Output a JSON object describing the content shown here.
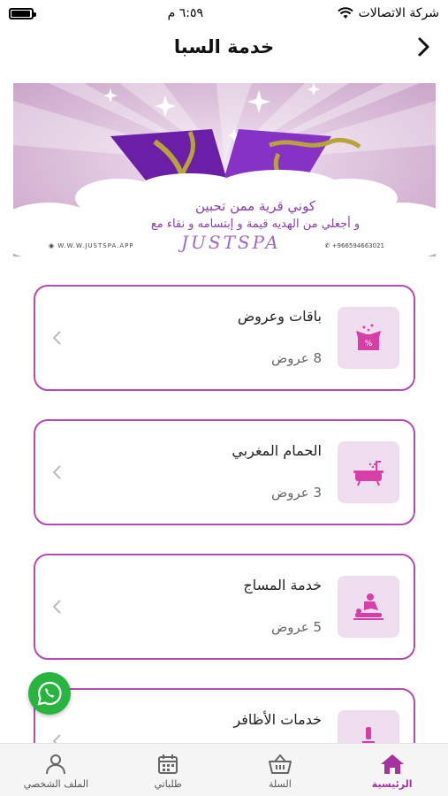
{
  "status_bar": {
    "carrier": "شركة الاتصالات",
    "time": "٦:٥٩ م",
    "battery_level": 0.95
  },
  "header": {
    "title": "خدمة السبا"
  },
  "banner": {
    "line1": "كوني قرية ممن تحبين",
    "line2": "و أجعلي من الهديه قيمة و إبتسامه و نقاء مع",
    "brand": "JUSTSPA",
    "website": "W.W.W.JUSTSPA.APP",
    "phone": "+966594663021",
    "colors": {
      "background": "#d9b9d6",
      "box": "#7b2cb8",
      "ribbon": "#b8a23a"
    }
  },
  "services": [
    {
      "name": "باقات وعروض",
      "count": "8 عروض",
      "icon": "gift-box-icon"
    },
    {
      "name": "الحمام المغربي",
      "count": "3 عروض",
      "icon": "bathtub-icon"
    },
    {
      "name": "خدمة المساج",
      "count": "5 عروض",
      "icon": "massage-icon"
    },
    {
      "name": "خدمات الأظافر",
      "count": "",
      "icon": "nail-polish-icon"
    }
  ],
  "tabs": [
    {
      "label": "الرئيسية",
      "icon": "home-icon",
      "active": true
    },
    {
      "label": "السلة",
      "icon": "basket-icon",
      "active": false
    },
    {
      "label": "طلباتي",
      "icon": "calendar-icon",
      "active": false
    },
    {
      "label": "الملف الشخصي",
      "icon": "user-icon",
      "active": false
    }
  ],
  "colors": {
    "accent": "#a6329f",
    "card_border": "#b34bb0",
    "thumb_bg": "#eedcef",
    "whatsapp": "#29b43f"
  }
}
